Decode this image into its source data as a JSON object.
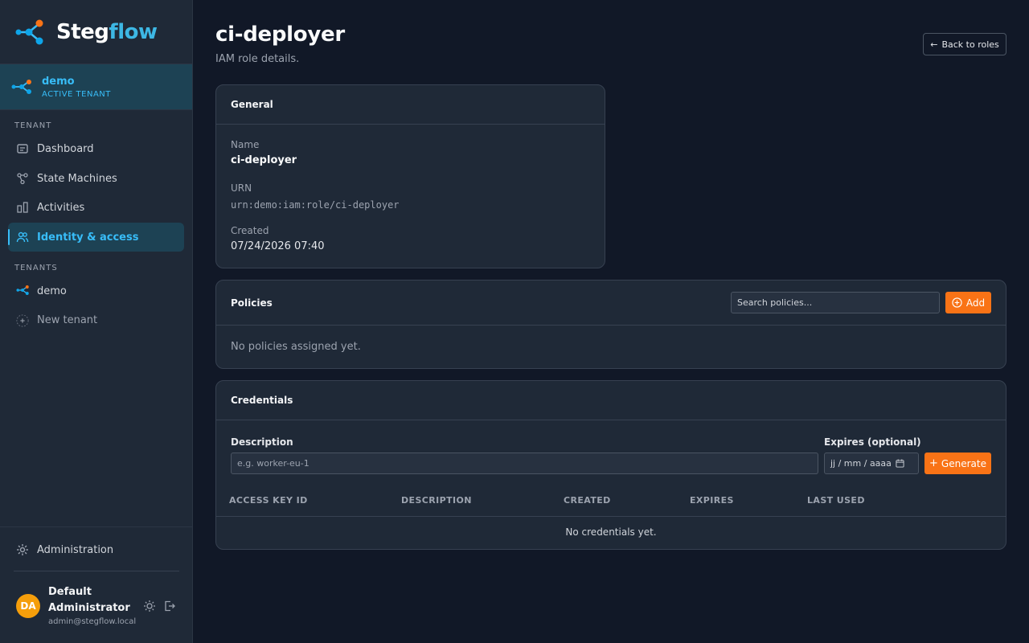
{
  "brand": {
    "part1": "Steg",
    "part2": "flow"
  },
  "active_tenant": {
    "name": "demo",
    "label": "ACTIVE TENANT"
  },
  "sidebar": {
    "tenant_section": "TENANT",
    "nav": [
      {
        "label": "Dashboard",
        "icon": "dashboard-icon"
      },
      {
        "label": "State Machines",
        "icon": "state-machines-icon"
      },
      {
        "label": "Activities",
        "icon": "activities-icon"
      },
      {
        "label": "Identity & access",
        "icon": "users-icon"
      }
    ],
    "tenants_section": "TENANTS",
    "tenants": [
      {
        "label": "demo"
      }
    ],
    "new_tenant": "New tenant",
    "admin": "Administration"
  },
  "user": {
    "initials": "DA",
    "name": "Default Administrator",
    "email": "admin@stegflow.local"
  },
  "page": {
    "title": "ci-deployer",
    "subtitle": "IAM role details.",
    "back": "Back to roles"
  },
  "general": {
    "title": "General",
    "name_label": "Name",
    "name_value": "ci-deployer",
    "urn_label": "URN",
    "urn_value": "urn:demo:iam:role/ci-deployer",
    "created_label": "Created",
    "created_value": "07/24/2026 07:40"
  },
  "policies": {
    "title": "Policies",
    "search_placeholder": "Search policies...",
    "add": "Add",
    "empty": "No policies assigned yet."
  },
  "credentials": {
    "title": "Credentials",
    "desc_label": "Description",
    "desc_placeholder": "e.g. worker-eu-1",
    "expires_label": "Expires (optional)",
    "expires_placeholder": "jj / mm / aaaa",
    "generate": "Generate",
    "columns": [
      "ACCESS KEY ID",
      "DESCRIPTION",
      "CREATED",
      "EXPIRES",
      "LAST USED"
    ],
    "empty": "No credentials yet."
  },
  "colors": {
    "accent": "#38bdf8",
    "orange": "#f97316",
    "bg": "#111827",
    "panel": "#1f2937"
  }
}
